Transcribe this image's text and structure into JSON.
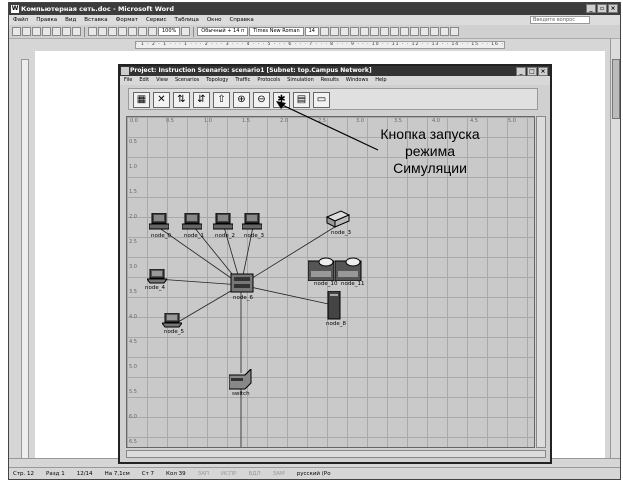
{
  "word": {
    "title": "Компьютерная сеть.doc - Microsoft Word",
    "menu": [
      "Файл",
      "Правка",
      "Вид",
      "Вставка",
      "Формат",
      "Сервис",
      "Таблица",
      "Окно",
      "Справка"
    ],
    "ask_placeholder": "Введите вопрос",
    "zoom": "100%",
    "style": "Обычный + 14 п",
    "font": "Times New Roman",
    "font_size": "14",
    "status": {
      "page": "Стр. 12",
      "section": "Разд 1",
      "pages": "12/14",
      "position": "На 7,1см",
      "line": "Ст 7",
      "col": "Кол 39",
      "modes": [
        "ЗАП",
        "ИСПР",
        "ВДЛ",
        "ЗАМ"
      ],
      "lang": "русский (Ро"
    }
  },
  "opnet": {
    "title": "Project: Instruction Scenario: scenario1  [Subnet: top.Campus Network]",
    "menu": [
      "File",
      "Edit",
      "View",
      "Scenarios",
      "Topology",
      "Traffic",
      "Protocols",
      "Simulation",
      "Results",
      "Windows",
      "Help"
    ],
    "x_ticks": [
      "0.0",
      "0.5",
      "1.0",
      "1.5",
      "2.0",
      "2.5",
      "3.0",
      "3.5",
      "4.0",
      "4.5",
      "5.0"
    ],
    "y_ticks": [
      "0.5",
      "1.0",
      "1.5",
      "2.0",
      "2.5",
      "3.0",
      "3.5",
      "4.0",
      "4.5",
      "5.0",
      "5.5",
      "6.0",
      "6.5"
    ],
    "nodes": {
      "node_0": "node_0",
      "node_1": "node_1",
      "node_2": "node_2",
      "node_3": "node_3",
      "node_4": "node_4",
      "node_5": "node_5",
      "node_6": "node_6",
      "node_7": "node_7",
      "node_8": "node_8",
      "node_10": "node_10",
      "node_11": "node_11",
      "switch": "switch"
    }
  },
  "annotation": {
    "line1": "Кнопка запуска",
    "line2": "режима",
    "line3": "Симуляции"
  }
}
